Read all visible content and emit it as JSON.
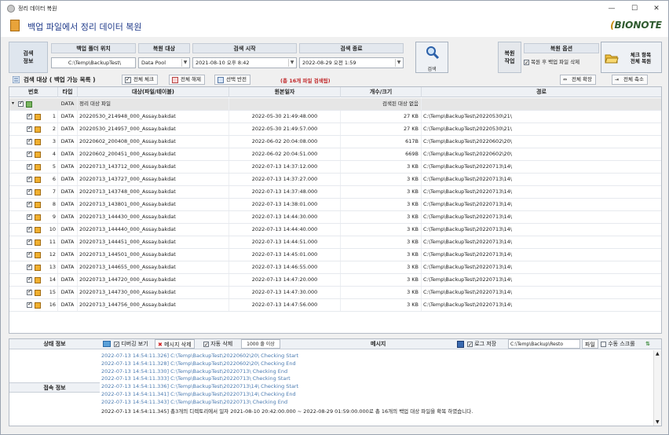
{
  "window": {
    "title": "정리 데이터 복원",
    "minimize": "—",
    "maximize": "☐",
    "close": "✕"
  },
  "header": {
    "title": "백업 파일에서 정리 데이터 복원",
    "logo_main": "BIONOTE",
    "logo_prefix": "("
  },
  "conditions": {
    "label": "검색\n정보",
    "backup_folder_header": "백업 폴더 위치",
    "backup_folder_value": "C:\\Temp\\BackupTest\\",
    "target_header": "복원 대상",
    "target_value": "Data Pool",
    "start_header": "검색 시작",
    "start_value": "2021-08-10 오후  8:42",
    "end_header": "검색 종료",
    "end_value": "2022-08-29 오전  1:59",
    "search_button": "검색",
    "restore_job_label": "복원\n작업",
    "restore_option_header": "복원 옵션",
    "restore_option_value": "복원 후 백업 파일 삭제",
    "restore_button": "체크 항목\n전체 복원"
  },
  "toolbar": {
    "title": "검색 대상 ( 백업 가능 목록 )",
    "check_all": "전체 체크",
    "uncheck_all": "전체 해제",
    "invert": "선택 반전",
    "count_text": "(총 16개 파일 검색됨)",
    "expand_all": "전체 확장",
    "collapse_all": "전체 축소"
  },
  "grid": {
    "headers": [
      "번호",
      "타입",
      "대상(파일/테이블)",
      "원본일자",
      "개수/크기",
      "경로"
    ],
    "group": {
      "type": "DATA",
      "name": "정리 대상 파일",
      "count": "검색된 대상 없음"
    },
    "rows": [
      {
        "no": "1",
        "type": "DATA",
        "name": "20220530_214948_000_Assay.bakdat",
        "date": "2022-05-30 21:49:48.000",
        "size": "27 KB",
        "path": "C:\\Temp\\BackupTest\\20220530\\21\\"
      },
      {
        "no": "2",
        "type": "DATA",
        "name": "20220530_214957_000_Assay.bakdat",
        "date": "2022-05-30 21:49:57.000",
        "size": "27 KB",
        "path": "C:\\Temp\\BackupTest\\20220530\\21\\"
      },
      {
        "no": "3",
        "type": "DATA",
        "name": "20220602_200408_000_Assay.bakdat",
        "date": "2022-06-02 20:04:08.000",
        "size": "617B",
        "path": "C:\\Temp\\BackupTest\\20220602\\20\\"
      },
      {
        "no": "4",
        "type": "DATA",
        "name": "20220602_200451_000_Assay.bakdat",
        "date": "2022-06-02 20:04:51.000",
        "size": "669B",
        "path": "C:\\Temp\\BackupTest\\20220602\\20\\"
      },
      {
        "no": "5",
        "type": "DATA",
        "name": "20220713_143712_000_Assay.bakdat",
        "date": "2022-07-13 14:37:12.000",
        "size": "3 KB",
        "path": "C:\\Temp\\BackupTest\\20220713\\14\\"
      },
      {
        "no": "6",
        "type": "DATA",
        "name": "20220713_143727_000_Assay.bakdat",
        "date": "2022-07-13 14:37:27.000",
        "size": "3 KB",
        "path": "C:\\Temp\\BackupTest\\20220713\\14\\"
      },
      {
        "no": "7",
        "type": "DATA",
        "name": "20220713_143748_000_Assay.bakdat",
        "date": "2022-07-13 14:37:48.000",
        "size": "3 KB",
        "path": "C:\\Temp\\BackupTest\\20220713\\14\\"
      },
      {
        "no": "8",
        "type": "DATA",
        "name": "20220713_143801_000_Assay.bakdat",
        "date": "2022-07-13 14:38:01.000",
        "size": "3 KB",
        "path": "C:\\Temp\\BackupTest\\20220713\\14\\"
      },
      {
        "no": "9",
        "type": "DATA",
        "name": "20220713_144430_000_Assay.bakdat",
        "date": "2022-07-13 14:44:30.000",
        "size": "3 KB",
        "path": "C:\\Temp\\BackupTest\\20220713\\14\\"
      },
      {
        "no": "10",
        "type": "DATA",
        "name": "20220713_144440_000_Assay.bakdat",
        "date": "2022-07-13 14:44:40.000",
        "size": "3 KB",
        "path": "C:\\Temp\\BackupTest\\20220713\\14\\"
      },
      {
        "no": "11",
        "type": "DATA",
        "name": "20220713_144451_000_Assay.bakdat",
        "date": "2022-07-13 14:44:51.000",
        "size": "3 KB",
        "path": "C:\\Temp\\BackupTest\\20220713\\14\\"
      },
      {
        "no": "12",
        "type": "DATA",
        "name": "20220713_144501_000_Assay.bakdat",
        "date": "2022-07-13 14:45:01.000",
        "size": "3 KB",
        "path": "C:\\Temp\\BackupTest\\20220713\\14\\"
      },
      {
        "no": "13",
        "type": "DATA",
        "name": "20220713_144655_000_Assay.bakdat",
        "date": "2022-07-13 14:46:55.000",
        "size": "3 KB",
        "path": "C:\\Temp\\BackupTest\\20220713\\14\\"
      },
      {
        "no": "14",
        "type": "DATA",
        "name": "20220713_144720_000_Assay.bakdat",
        "date": "2022-07-13 14:47:20.000",
        "size": "3 KB",
        "path": "C:\\Temp\\BackupTest\\20220713\\14\\"
      },
      {
        "no": "15",
        "type": "DATA",
        "name": "20220713_144730_000_Assay.bakdat",
        "date": "2022-07-13 14:47:30.000",
        "size": "3 KB",
        "path": "C:\\Temp\\BackupTest\\20220713\\14\\"
      },
      {
        "no": "16",
        "type": "DATA",
        "name": "20220713_144756_000_Assay.bakdat",
        "date": "2022-07-13 14:47:56.000",
        "size": "3 KB",
        "path": "C:\\Temp\\BackupTest\\20220713\\14\\"
      }
    ]
  },
  "bottom": {
    "status_label": "상태 정보",
    "conn_label": "접속 정보",
    "debug_view": "디버깅 보기",
    "delete_msg": "메시지 삭제",
    "auto_delete": "자동 삭제",
    "max_lines": "1000 줄 이상",
    "message_header": "메시지",
    "log_save": "로그 저장",
    "log_path": "C:\\Temp\\Backup\\Resto",
    "file_button": "파일",
    "manual_scroll": "수동 스크롤",
    "log_lines": [
      "2022-07-13 14:54:11.326]  C:\\Temp\\BackupTest\\20220602\\20\\ Checking Start",
      "2022-07-13 14:54:11.328]  C:\\Temp\\BackupTest\\20220602\\20\\ Checking End",
      "2022-07-13 14:54:11.330]  C:\\Temp\\BackupTest\\20220713\\ Checking End",
      "2022-07-13 14:54:11.333]  C:\\Temp\\BackupTest\\20220713\\ Checking Start",
      "2022-07-13 14:54:11.336]  C:\\Temp\\BackupTest\\20220713\\14\\ Checking Start",
      "2022-07-13 14:54:11.341]  C:\\Temp\\BackupTest\\20220713\\14\\ Checking End",
      "2022-07-13 14:54:11.343]  C:\\Temp\\BackupTest\\20220713\\ Checking End",
      "2022-07-13 14:54:11.345]   총3개의 디렉토리에서 일자 2021-08-10 20:42:00.000 ~ 2022-08-29 01:59:00.000로 총 16개의 백업 대상 파일을 확복 하였습니다."
    ]
  }
}
